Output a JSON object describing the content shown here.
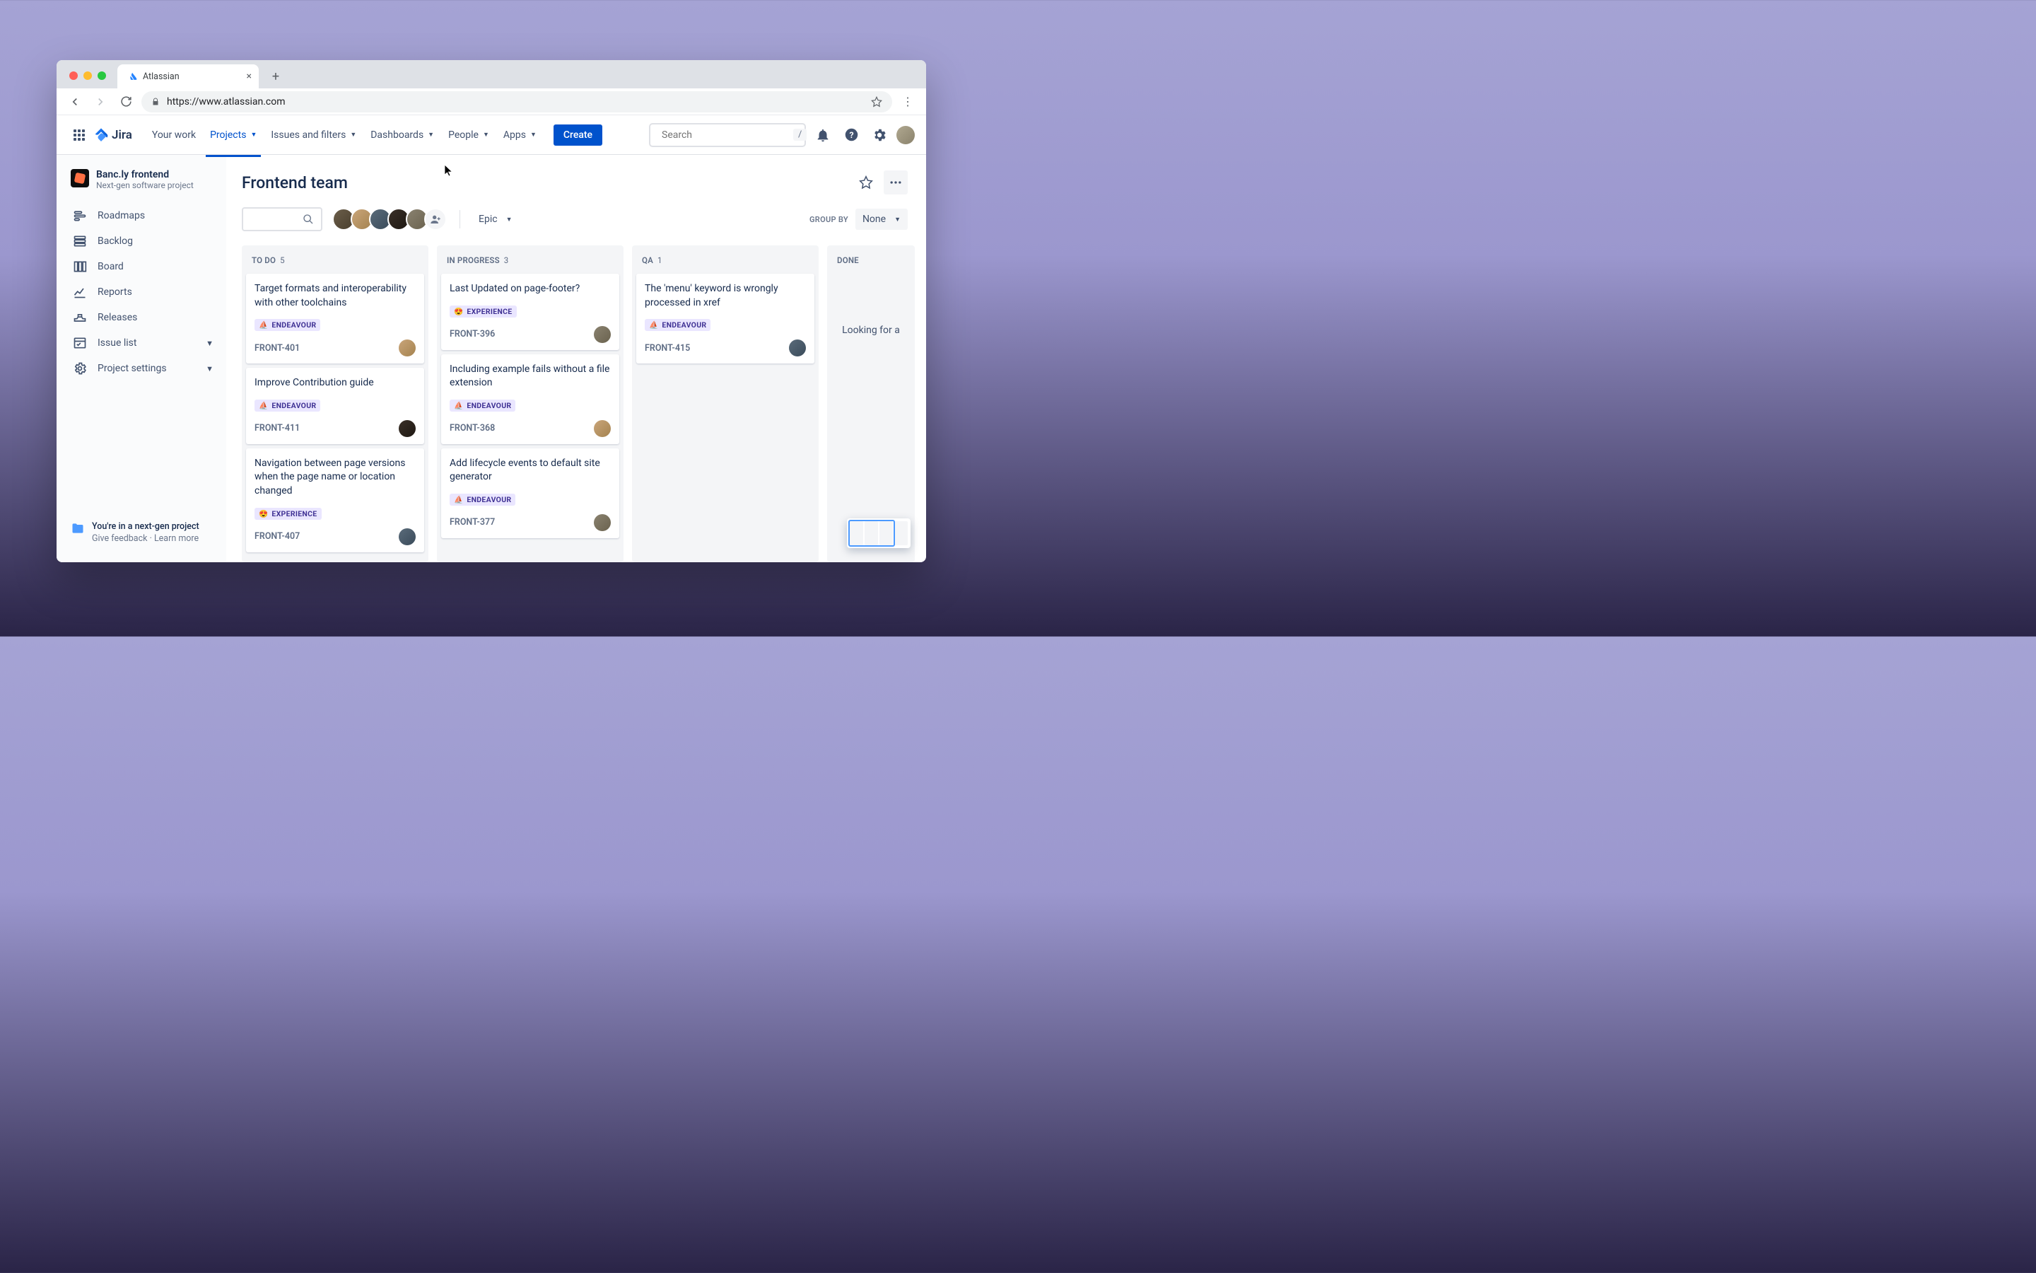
{
  "browser": {
    "tab_title": "Atlassian",
    "url": "https://www.atlassian.com"
  },
  "topnav": {
    "product": "Jira",
    "your_work": "Your work",
    "projects": "Projects",
    "issues": "Issues and filters",
    "dashboards": "Dashboards",
    "people": "People",
    "apps": "Apps",
    "create": "Create",
    "search_placeholder": "Search",
    "search_shortcut": "/"
  },
  "sidebar": {
    "project_name": "Banc.ly frontend",
    "project_sub": "Next-gen software project",
    "items": {
      "roadmaps": "Roadmaps",
      "backlog": "Backlog",
      "board": "Board",
      "reports": "Reports",
      "releases": "Releases",
      "issue_list": "Issue list",
      "project_settings": "Project settings"
    },
    "footer_line1": "You're in a next-gen project",
    "footer_feedback": "Give feedback",
    "footer_learn": "Learn more"
  },
  "board": {
    "title": "Frontend team",
    "epic_filter": "Epic",
    "group_by_label": "GROUP BY",
    "group_by_value": "None"
  },
  "columns": [
    {
      "name": "TO DO",
      "count": "5",
      "cards": [
        {
          "title": "Target formats and interoperability with other toolchains",
          "epic_emoji": "⛵",
          "epic": "ENDEAVOUR",
          "key": "FRONT-401",
          "assignee_class": "av2"
        },
        {
          "title": "Improve Contribution guide",
          "epic_emoji": "⛵",
          "epic": "ENDEAVOUR",
          "key": "FRONT-411",
          "assignee_class": "av4"
        },
        {
          "title": "Navigation between page versions when the page name or location changed",
          "epic_emoji": "😍",
          "epic": "EXPERIENCE",
          "key": "FRONT-407",
          "assignee_class": "av3"
        }
      ]
    },
    {
      "name": "IN PROGRESS",
      "count": "3",
      "cards": [
        {
          "title": "Last Updated on page-footer?",
          "epic_emoji": "😍",
          "epic": "EXPERIENCE",
          "key": "FRONT-396",
          "assignee_class": "av5"
        },
        {
          "title": "Including example fails without a file extension",
          "epic_emoji": "⛵",
          "epic": "ENDEAVOUR",
          "key": "FRONT-368",
          "assignee_class": "av2"
        },
        {
          "title": "Add lifecycle events to default site generator",
          "epic_emoji": "⛵",
          "epic": "ENDEAVOUR",
          "key": "FRONT-377",
          "assignee_class": "av5"
        }
      ]
    },
    {
      "name": "QA",
      "count": "1",
      "cards": [
        {
          "title": "The 'menu' keyword is wrongly processed in xref",
          "epic_emoji": "⛵",
          "epic": "ENDEAVOUR",
          "key": "FRONT-415",
          "assignee_class": "av3"
        }
      ]
    },
    {
      "name": "DONE",
      "count": "",
      "empty_text": "Looking for a",
      "cards": []
    }
  ]
}
